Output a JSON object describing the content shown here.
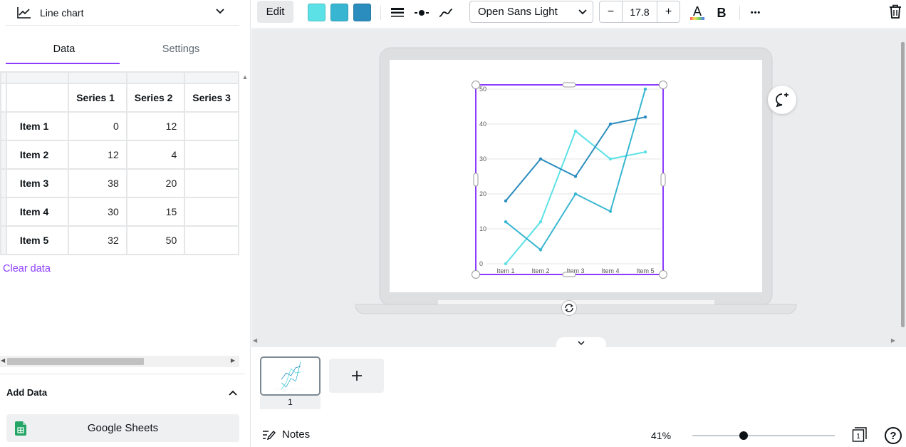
{
  "left_panel": {
    "chart_type": "Line chart",
    "tabs": [
      "Data",
      "Settings"
    ],
    "table": {
      "columns": [
        "Series 1",
        "Series 2",
        "Series 3"
      ],
      "rows": [
        {
          "label": "Item 1",
          "values": [
            "0",
            "12"
          ]
        },
        {
          "label": "Item 2",
          "values": [
            "12",
            "4"
          ]
        },
        {
          "label": "Item 3",
          "values": [
            "38",
            "20"
          ]
        },
        {
          "label": "Item 4",
          "values": [
            "30",
            "15"
          ]
        },
        {
          "label": "Item 5",
          "values": [
            "32",
            "50"
          ]
        }
      ]
    },
    "clear_data": "Clear data",
    "add_data": "Add Data",
    "google_sheets": "Google Sheets"
  },
  "toolbar": {
    "edit": "Edit",
    "swatches": [
      "#5ce1e6",
      "#38b6d1",
      "#2b8cbe"
    ],
    "font": "Open Sans Light",
    "font_size": "17.8",
    "minus": "−",
    "plus": "+",
    "text_color_letter": "A",
    "bold_letter": "B",
    "more": "•••"
  },
  "pages": {
    "current_page": "1"
  },
  "footer": {
    "notes": "Notes",
    "zoom": "41%",
    "page_count": "1",
    "help": "?"
  },
  "colors": {
    "accent": "#8b3dff",
    "series1": "#5ce1e6",
    "series2": "#38b6d1",
    "series3": "#2b8cbe"
  },
  "chart_data": {
    "type": "line",
    "categories": [
      "Item 1",
      "Item 2",
      "Item 3",
      "Item 4",
      "Item 5"
    ],
    "series": [
      {
        "name": "Series 1",
        "color": "#5ce1e6",
        "values": [
          0,
          12,
          38,
          30,
          32
        ]
      },
      {
        "name": "Series 2",
        "color": "#38b6d1",
        "values": [
          12,
          4,
          20,
          15,
          50
        ]
      },
      {
        "name": "Series 3",
        "color": "#2b8cbe",
        "values": [
          18,
          30,
          25,
          40,
          42
        ]
      }
    ],
    "yticks": [
      "0",
      "10",
      "20",
      "30",
      "40",
      "50"
    ],
    "ylim": [
      0,
      50
    ],
    "grid": true
  }
}
